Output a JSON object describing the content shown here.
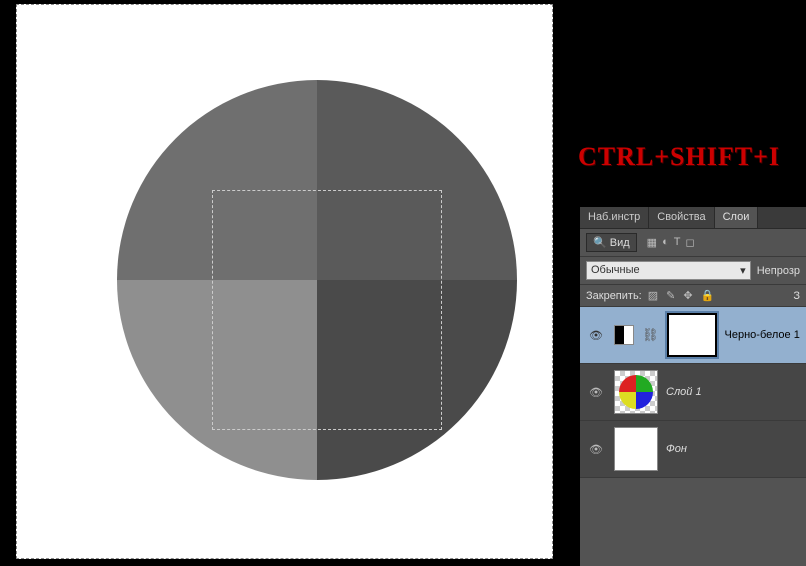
{
  "shortcut": {
    "text": "CTRL+SHIFT+I"
  },
  "tabs": {
    "presets": "Наб.инстр",
    "properties": "Свойства",
    "layers": "Слои"
  },
  "filter": {
    "label": "Вид",
    "searchGlyph": "🔍"
  },
  "blend": {
    "mode": "Обычные",
    "opacityLabel": "Непрозр"
  },
  "lock": {
    "label": "Закрепить:",
    "fillLabel": "З"
  },
  "layers": [
    {
      "name": "Черно-белое 1",
      "type": "adjustment",
      "selected": true
    },
    {
      "name": "Слой 1",
      "type": "circle",
      "selected": false
    },
    {
      "name": "Фон",
      "type": "background",
      "selected": false
    }
  ],
  "colors": {
    "qTL": "#6f6f6f",
    "qTR": "#5a5a5a",
    "qBL": "#8f8f8f",
    "qBR": "#4a4a4a"
  }
}
